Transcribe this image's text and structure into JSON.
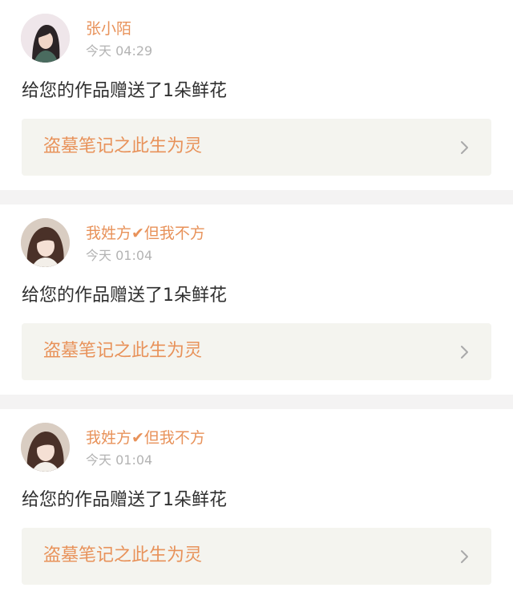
{
  "notifications": [
    {
      "username": "张小陌",
      "time": "今天 04:29",
      "message": "给您的作品赠送了1朵鲜花",
      "work_title": "盗墓笔记之此生为灵",
      "avatar_icon": "user-avatar-icon"
    },
    {
      "username": "我姓方✔但我不方",
      "time": "今天 01:04",
      "message": "给您的作品赠送了1朵鲜花",
      "work_title": "盗墓笔记之此生为灵",
      "avatar_icon": "user-avatar-icon"
    },
    {
      "username": "我姓方✔但我不方",
      "time": "今天 01:04",
      "message": "给您的作品赠送了1朵鲜花",
      "work_title": "盗墓笔记之此生为灵",
      "avatar_icon": "user-avatar-icon"
    }
  ],
  "colors": {
    "accent": "#e8925a",
    "timestamp": "#b3b3b3",
    "link_background": "#f4f4ef",
    "divider": "#f4f3f3"
  }
}
